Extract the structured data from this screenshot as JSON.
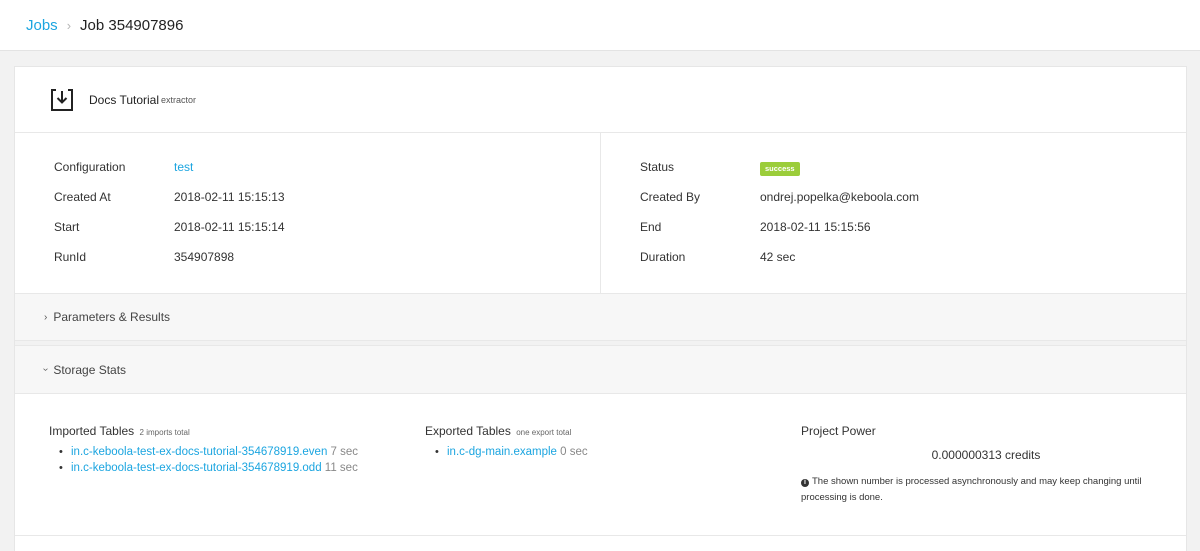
{
  "breadcrumb": {
    "parent": "Jobs",
    "separator": "›",
    "current": "Job 354907896"
  },
  "component": {
    "icon": "download-box-icon",
    "name": "Docs Tutorial",
    "type": "extractor"
  },
  "details_left": [
    {
      "label": "Configuration",
      "value": "test",
      "is_link": true
    },
    {
      "label": "Created At",
      "value": "2018-02-11 15:15:13",
      "is_link": false
    },
    {
      "label": "Start",
      "value": "2018-02-11 15:15:14",
      "is_link": false
    },
    {
      "label": "RunId",
      "value": "354907898",
      "is_link": false
    }
  ],
  "details_right": {
    "status": {
      "label": "Status",
      "value": "success",
      "color": "#9bcd3a"
    },
    "created_by": {
      "label": "Created By",
      "value": "ondrej.popelka@keboola.com"
    },
    "end": {
      "label": "End",
      "value": "2018-02-11 15:15:56"
    },
    "duration": {
      "label": "Duration",
      "value": "42 sec"
    }
  },
  "panels": {
    "parameters": {
      "label": "Parameters & Results",
      "chevron": "›"
    },
    "storage": {
      "label": "Storage Stats",
      "chevron": "›"
    }
  },
  "storage": {
    "imported": {
      "title": "Imported Tables",
      "subtitle": "2 imports total",
      "items": [
        {
          "table": "in.c-keboola-test-ex-docs-tutorial-354678919.even",
          "time": "7 sec"
        },
        {
          "table": "in.c-keboola-test-ex-docs-tutorial-354678919.odd",
          "time": "11 sec"
        }
      ]
    },
    "exported": {
      "title": "Exported Tables",
      "subtitle": "one export total",
      "items": [
        {
          "table": "in.c-dg-main.example",
          "time": "0 sec"
        }
      ]
    },
    "power": {
      "title": "Project Power",
      "value": "0.000000313 credits",
      "note": "The shown number is processed asynchronously and may keep changing until processing is done."
    }
  },
  "colors": {
    "link": "#1ba5e0",
    "success": "#9bcd3a"
  }
}
